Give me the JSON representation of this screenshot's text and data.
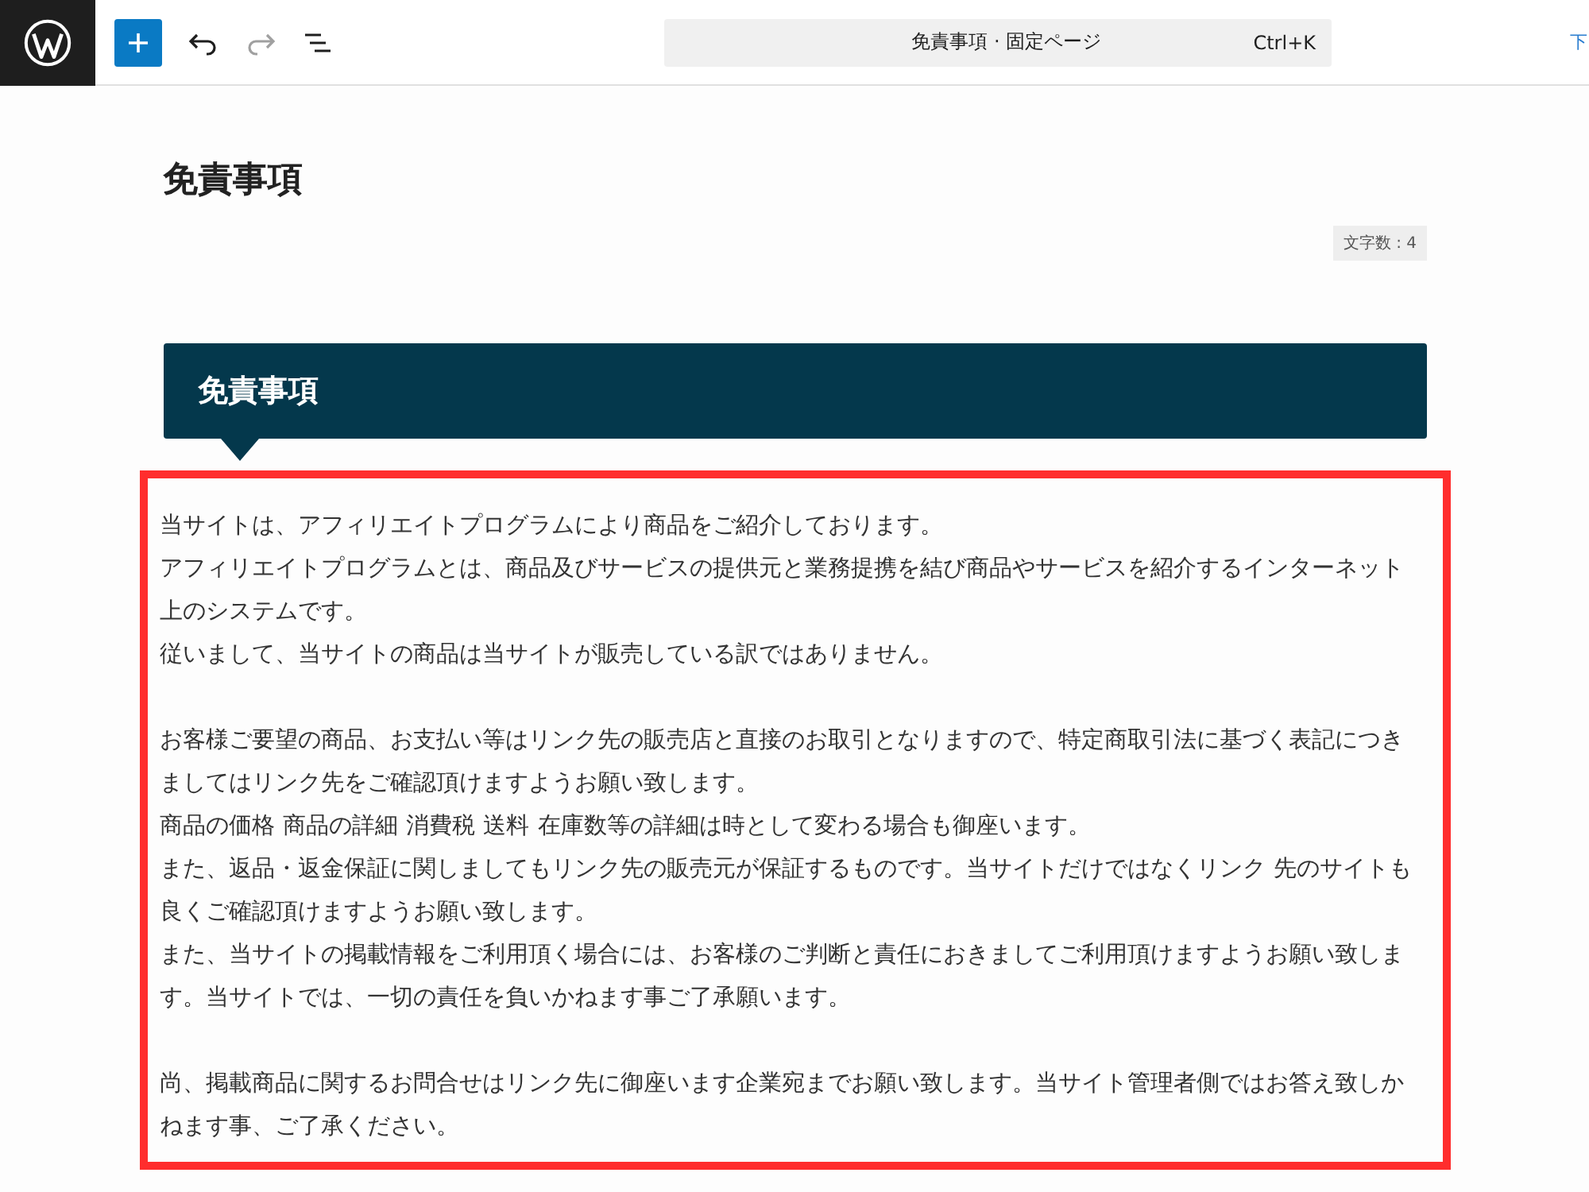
{
  "toolbar": {
    "search": {
      "title": "免責事項 · 固定ページ",
      "shortcut": "Ctrl+K"
    },
    "edge_link": "下"
  },
  "page": {
    "title": "免責事項",
    "char_count": "文字数 : 4",
    "heading": "免責事項",
    "paragraphs": [
      [
        "当サイトは、アフィリエイトプログラムにより商品をご紹介しております。",
        "アフィリエイトプログラムとは、商品及びサービスの提供元と業務提携を結び商品やサービスを紹介するインターネット上のシステムです。",
        "従いまして、当サイトの商品は当サイトが販売している訳ではありません。"
      ],
      [
        "お客様ご要望の商品、お支払い等はリンク先の販売店と直接のお取引となりますので、特定商取引法に基づく表記につきましてはリンク先をご確認頂けますようお願い致します。",
        "商品の価格 商品の詳細 消費税 送料 在庫数等の詳細は時として変わる場合も御座います。",
        "また、返品・返金保証に関しましてもリンク先の販売元が保証するものです。当サイトだけではなくリンク 先のサイトも良くご確認頂けますようお願い致します。",
        "また、当サイトの掲載情報をご利用頂く場合には、お客様のご判断と責任におきましてご利用頂けますようお願い致します。当サイトでは、一切の責任を負いかねます事ご了承願います。"
      ],
      [
        "尚、掲載商品に関するお問合せはリンク先に御座います企業宛までお願い致します。当サイト管理者側ではお答え致しかねます事、ご了承ください。"
      ]
    ]
  }
}
